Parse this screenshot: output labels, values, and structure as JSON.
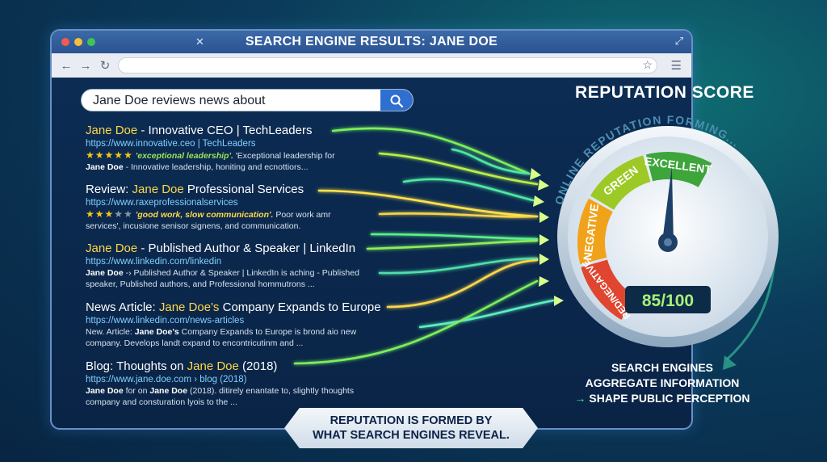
{
  "window": {
    "title": "SEARCH ENGINE RESULTS: JANE DOE",
    "traffic_colors": [
      "#ef5b52",
      "#f6be3a",
      "#3fc356"
    ]
  },
  "search": {
    "query": "Jane Doe reviews news about"
  },
  "results": [
    {
      "title_hl": "Jane Doe",
      "title_rest": " - Innovative CEO | TechLeaders",
      "url": "https://www.innovative.ceo | TechLeaders",
      "rating": 5,
      "quote": "'exceptional leadership'.",
      "line1_rest": " 'Exceptional leadership for",
      "line2_bold": "Jane Doe",
      "line2_rest": " - Innovative leadership, honiting and ecnottiors..."
    },
    {
      "title_pre": "Review: ",
      "title_hl": "Jane Doe",
      "title_rest": " Professional Services",
      "url": "https://www.raxeprofessionalservices",
      "rating": 3,
      "quote": "'good work, slow communication'.",
      "line1_rest": " Poor work amr",
      "line2_rest": "services', incusione senisor signens, and communication."
    },
    {
      "title_hl": "Jane Doe",
      "title_rest": " - Published Author & Speaker | LinkedIn",
      "url": "https://www.linkedin.com/linkedin",
      "line1_bold": "Jane Doe",
      "line1_rest": " -› Published Author & Speaker | LinkedIn is aching - Published",
      "line2_rest": "speaker, Published authors, and Professional hommutrons ..."
    },
    {
      "title_pre": "News Article: ",
      "title_hl": "Jane Doe's",
      "title_rest": " Company Expands to Europe",
      "url": "https://www.linkedin.com/news-articles",
      "line1_pre": "New. Article: ",
      "line1_bold": "Jane Doe's",
      "line1_rest": " Company Expands to Europe is brond aio new",
      "line2_rest": "company. Develops landt expand to encontricutinm and ..."
    },
    {
      "title_pre": "Blog: Thoughts on ",
      "title_hl": "Jane Doe",
      "title_rest": " (2018)",
      "url": "https://www.jane.doe.com › blog (2018)",
      "line1_bold": "Jane Doe",
      "line1_mid": " for on ",
      "line1_bold2": "Jane Doe",
      "line1_rest": " (2018). ditirely enantate to, slightly thoughts",
      "line2_rest": "company and consturation lyois to the ..."
    }
  ],
  "reputation": {
    "title": "REPUTATION SCORE",
    "arc_text": "ONLINE REPUTATION FORMING...",
    "segments": [
      {
        "label": "RED/NEGATIVE",
        "color": "#e0452f"
      },
      {
        "label": "NEGATIVE",
        "color": "#f0a21a"
      },
      {
        "label": "GREEN",
        "color": "#9cc925"
      },
      {
        "label": "EXCELLENT",
        "color": "#3da53a"
      }
    ],
    "score_text": "85/100",
    "score_value": 85,
    "score_max": 100
  },
  "info": {
    "line1": "SEARCH ENGINES",
    "line2": "AGGREGATE INFORMATION",
    "arrow": "→",
    "line3": "SHAPE PUBLIC PERCEPTION"
  },
  "banner": {
    "line1": "REPUTATION IS FORMED BY",
    "line2": "WHAT SEARCH ENGINES REVEAL."
  }
}
